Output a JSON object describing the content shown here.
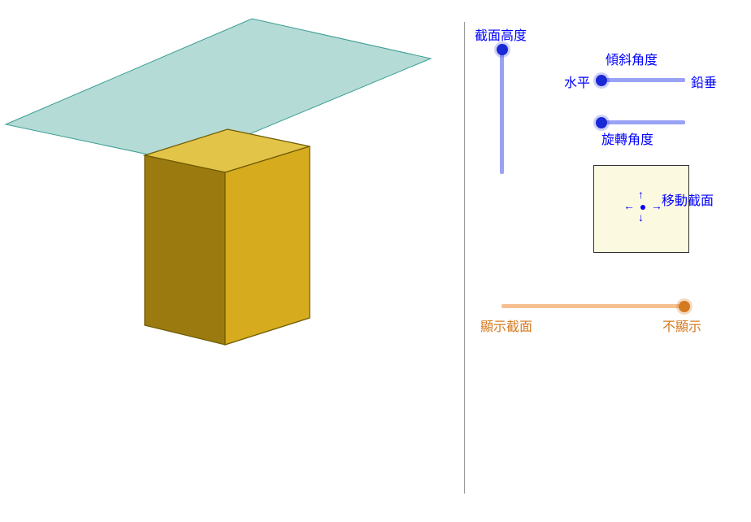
{
  "sliders": {
    "height": {
      "label": "截面高度",
      "value": 1.0
    },
    "tilt": {
      "label": "傾斜角度",
      "left_label": "水平",
      "right_label": "鉛垂",
      "value": 0.0
    },
    "rotate": {
      "label": "旋轉角度",
      "value": 0.0
    },
    "show": {
      "left_label": "顯示截面",
      "right_label": "不顯示",
      "value": 1.0
    }
  },
  "joystick": {
    "label": "移動截面",
    "arrows": {
      "up": "↑",
      "down": "↓",
      "left": "←",
      "right": "→"
    }
  },
  "colors": {
    "blue_label": "#0000ff",
    "slider_track": "#9aa2f5",
    "slider_thumb": "#1a29d6",
    "orange_label": "#d57a1f",
    "orange_track": "#f5bf90",
    "plane_fill": "#a8d5cf",
    "cube_top": "#e7c84c",
    "cube_left": "#9b7b0f",
    "cube_right": "#d6ab1e"
  },
  "scene": {
    "object": "rectangular-prism",
    "plane_visible": true,
    "plane_position": "top"
  }
}
